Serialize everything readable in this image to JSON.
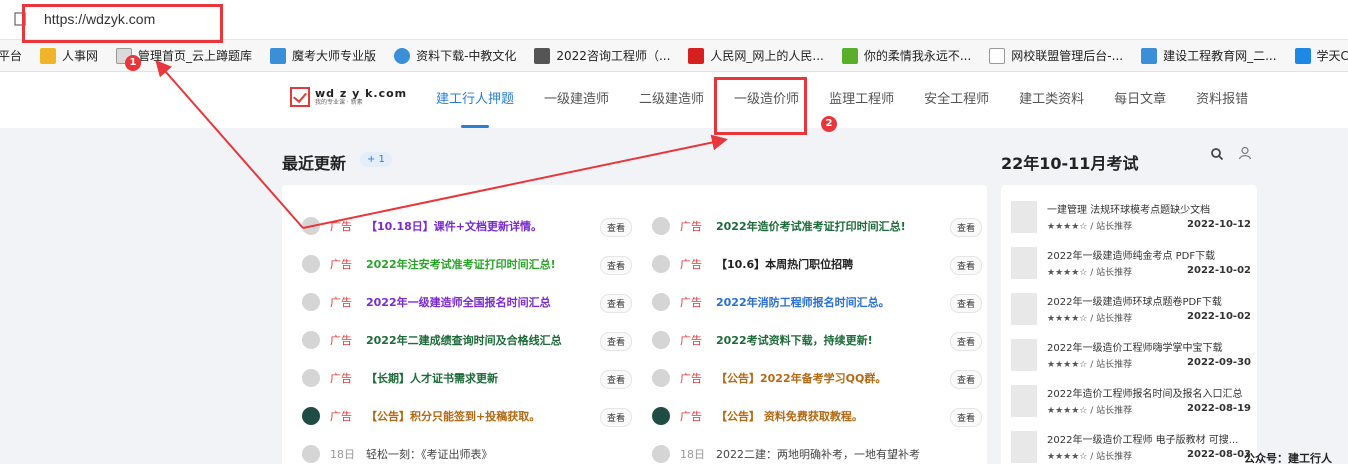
{
  "browser": {
    "url": "https://wdzyk.com",
    "bookmarks": [
      {
        "label": "平台",
        "icon": "none",
        "color": ""
      },
      {
        "label": "人事网",
        "icon": "folder-icon",
        "color": "#f0b429"
      },
      {
        "label": "管理首页_云上蹲题库",
        "icon": "page-icon",
        "color": "#d9d9d9"
      },
      {
        "label": "魔考大师专业版",
        "icon": "site-icon",
        "color": "#3b8fd8"
      },
      {
        "label": "资料下载-中教文化",
        "icon": "globe-icon",
        "color": "#3b8fd8"
      },
      {
        "label": "2022咨询工程师（...",
        "icon": "grid-icon",
        "color": "#555555"
      },
      {
        "label": "人民网_网上的人民...",
        "icon": "site-icon",
        "color": "#d61f1f"
      },
      {
        "label": "你的柔情我永远不...",
        "icon": "site-icon",
        "color": "#5aaf2a"
      },
      {
        "label": "网校联盟管理后台-...",
        "icon": "page-icon",
        "color": "#ffffff"
      },
      {
        "label": "建设工程教育网_二...",
        "icon": "site-icon",
        "color": "#3b8fd8"
      },
      {
        "label": "学天CRM",
        "icon": "site-icon",
        "color": "#1e88e5"
      }
    ]
  },
  "site": {
    "logo_text": "wd z y k.com",
    "logo_sub": "我的专业课 · 新素",
    "nav": [
      {
        "label": "建工行人押题",
        "active": true
      },
      {
        "label": "一级建造师",
        "active": false
      },
      {
        "label": "二级建造师",
        "active": false
      },
      {
        "label": "一级造价师",
        "active": false
      },
      {
        "label": "监理工程师",
        "active": false
      },
      {
        "label": "安全工程师",
        "active": false
      },
      {
        "label": "建工类资料",
        "active": false
      },
      {
        "label": "每日文章",
        "active": false
      },
      {
        "label": "资料报错",
        "active": false
      }
    ]
  },
  "recent": {
    "title": "最近更新",
    "badge": "+ 1",
    "view_label": "查看",
    "left": [
      {
        "tag": "广告",
        "title": "【10.18日】课件+文档更新详情。",
        "color": "#7b2ad0"
      },
      {
        "tag": "广告",
        "title": "2022年注安考试准考证打印时间汇总!",
        "color": "#2aa52a"
      },
      {
        "tag": "广告",
        "title": "2022年一级建造师全国报名时间汇总",
        "color": "#7b2ad0"
      },
      {
        "tag": "广告",
        "title": "2022年二建成绩查询时间及合格线汇总",
        "color": "#1e6b3a"
      },
      {
        "tag": "广告",
        "title": "【长期】人才证书需求更新",
        "color": "#1e6b3a"
      },
      {
        "tag": "广告",
        "title": "【公告】积分只能签到+投稿获取。",
        "color": "#b46a14"
      },
      {
        "tag": "18日",
        "title": "轻松一刻：《考证出师表》",
        "color": "#444444"
      }
    ],
    "right": [
      {
        "tag": "广告",
        "title": "2022年造价考试准考证打印时间汇总!",
        "color": "#1e6b3a"
      },
      {
        "tag": "广告",
        "title": "【10.6】本周热门职位招聘",
        "color": "#222222"
      },
      {
        "tag": "广告",
        "title": "2022年消防工程师报名时间汇总。",
        "color": "#2a6fd4"
      },
      {
        "tag": "广告",
        "title": "2022考试资料下载，持续更新!",
        "color": "#1e6b3a"
      },
      {
        "tag": "广告",
        "title": "【公告】2022年备考学习QQ群。",
        "color": "#b46a14"
      },
      {
        "tag": "广告",
        "title": "【公告】 资料免费获取教程。",
        "color": "#b46a14"
      },
      {
        "tag": "18日",
        "title": "2022二建：两地明确补考，一地有望补考",
        "color": "#444444"
      }
    ]
  },
  "exam": {
    "title": "22年10-11月考试",
    "items": [
      {
        "title": "一建管理 法规环球模考点题缺少文档",
        "meta": "★★★★☆ / 站长推荐",
        "date": "2022-10-12"
      },
      {
        "title": "2022年一级建造师纯金考点 PDF下载",
        "meta": "★★★★☆ / 站长推荐",
        "date": "2022-10-02"
      },
      {
        "title": "2022年一级建造师环球点题卷PDF下载",
        "meta": "★★★★☆ / 站长推荐",
        "date": "2022-10-02"
      },
      {
        "title": "2022年一级造价工程师嗨学掌中宝下载",
        "meta": "★★★★☆ / 站长推荐",
        "date": "2022-09-30"
      },
      {
        "title": "2022年造价工程师报名时间及报名入口汇总",
        "meta": "★★★★☆ / 站长推荐",
        "date": "2022-08-19"
      },
      {
        "title": "2022年一级造价工程师 电子版教材 可搜...",
        "meta": "★★★★☆ / 站长推荐",
        "date": "2022-08-03"
      }
    ]
  },
  "annotations": {
    "badge1": "1",
    "badge2": "2",
    "color": "#e8363a"
  },
  "watermark": "公众号：建工行人"
}
